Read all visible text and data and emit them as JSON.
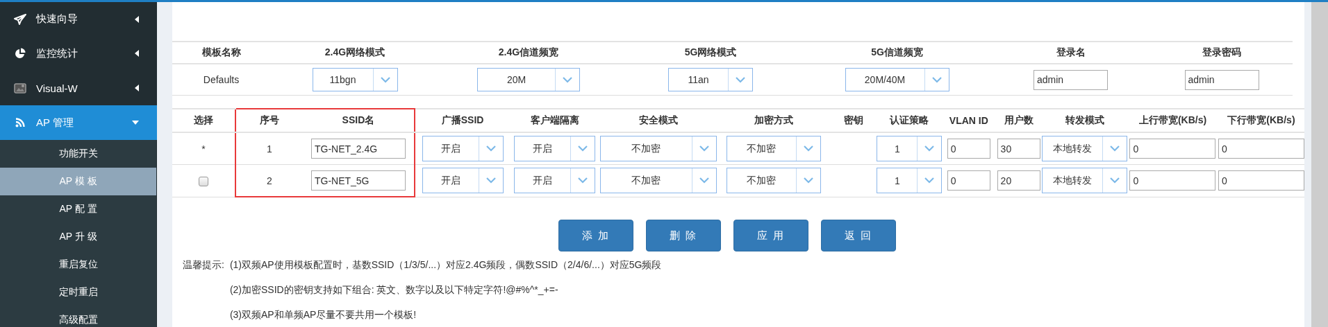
{
  "sidebar": {
    "items": [
      {
        "label": "快速向导",
        "selected": false,
        "expanded": false
      },
      {
        "label": "监控统计",
        "selected": false,
        "expanded": false
      },
      {
        "label": "Visual-W",
        "selected": false,
        "expanded": false
      },
      {
        "label": "AP 管理",
        "selected": true,
        "expanded": true,
        "children": [
          {
            "label": "功能开关",
            "selected": false
          },
          {
            "label": "AP 模 板",
            "selected": true
          },
          {
            "label": "AP 配 置",
            "selected": false
          },
          {
            "label": "AP 升 级",
            "selected": false
          },
          {
            "label": "重启复位",
            "selected": false
          },
          {
            "label": "定时重启",
            "selected": false
          },
          {
            "label": "高级配置",
            "selected": false
          }
        ]
      }
    ]
  },
  "template_table": {
    "columns": [
      "模板名称",
      "2.4G网络模式",
      "2.4G信道频宽",
      "5G网络模式",
      "5G信道频宽",
      "登录名",
      "登录密码"
    ],
    "rows": [
      {
        "cells": [
          {
            "kind": "text",
            "value": "Defaults"
          },
          {
            "kind": "select",
            "value": "11bgn"
          },
          {
            "kind": "select",
            "value": "20M"
          },
          {
            "kind": "select",
            "value": "11an"
          },
          {
            "kind": "select",
            "value": "20M/40M"
          },
          {
            "kind": "input",
            "value": "admin"
          },
          {
            "kind": "input",
            "value": "admin"
          }
        ]
      }
    ]
  },
  "ssid_table": {
    "columns": [
      {
        "label": "选择",
        "highlighted": false
      },
      {
        "label": "序号",
        "highlighted": true
      },
      {
        "label": "SSID名",
        "highlighted": true
      },
      {
        "label": "广播SSID",
        "highlighted": false
      },
      {
        "label": "客户端隔离",
        "highlighted": false
      },
      {
        "label": "安全模式",
        "highlighted": false
      },
      {
        "label": "加密方式",
        "highlighted": false
      },
      {
        "label": "密钥",
        "highlighted": false
      },
      {
        "label": "认证策略",
        "highlighted": false
      },
      {
        "label": "VLAN ID",
        "highlighted": false
      },
      {
        "label": "用户数",
        "highlighted": false
      },
      {
        "label": "转发模式",
        "highlighted": false
      },
      {
        "label": "上行带宽(KB/s)",
        "highlighted": false
      },
      {
        "label": "下行带宽(KB/s)",
        "highlighted": false
      }
    ],
    "rows": [
      {
        "cells": [
          {
            "kind": "text",
            "value": "*"
          },
          {
            "kind": "text",
            "value": "1"
          },
          {
            "kind": "input",
            "value": "TG-NET_2.4G"
          },
          {
            "kind": "select",
            "value": "开启"
          },
          {
            "kind": "select",
            "value": "开启"
          },
          {
            "kind": "select",
            "value": "不加密"
          },
          {
            "kind": "select",
            "value": "不加密"
          },
          {
            "kind": "blank"
          },
          {
            "kind": "select",
            "value": "1"
          },
          {
            "kind": "input",
            "value": "0"
          },
          {
            "kind": "input",
            "value": "30"
          },
          {
            "kind": "select",
            "value": "本地转发"
          },
          {
            "kind": "input",
            "value": "0"
          },
          {
            "kind": "input",
            "value": "0"
          }
        ]
      },
      {
        "cells": [
          {
            "kind": "checkbox",
            "checked": false
          },
          {
            "kind": "text",
            "value": "2"
          },
          {
            "kind": "input",
            "value": "TG-NET_5G"
          },
          {
            "kind": "select",
            "value": "开启"
          },
          {
            "kind": "select",
            "value": "开启"
          },
          {
            "kind": "select",
            "value": "不加密"
          },
          {
            "kind": "select",
            "value": "不加密"
          },
          {
            "kind": "blank"
          },
          {
            "kind": "select",
            "value": "1"
          },
          {
            "kind": "input",
            "value": "0"
          },
          {
            "kind": "input",
            "value": "20"
          },
          {
            "kind": "select",
            "value": "本地转发"
          },
          {
            "kind": "input",
            "value": "0"
          },
          {
            "kind": "input",
            "value": "0"
          }
        ]
      }
    ]
  },
  "buttons": [
    "添 加",
    "删 除",
    "应 用",
    "返 回"
  ],
  "tips": {
    "label": "温馨提示:",
    "notes": [
      "(1)双频AP使用模板配置时，基数SSID（1/3/5/...）对应2.4G频段，偶数SSID（2/4/6/...）对应5G频段",
      "(2)加密SSID的密钥支持如下组合: 英文、数字以及以下特定字符!@#%^*_+=-",
      "(3)双频AP和单频AP尽量不要共用一个模板!"
    ]
  }
}
